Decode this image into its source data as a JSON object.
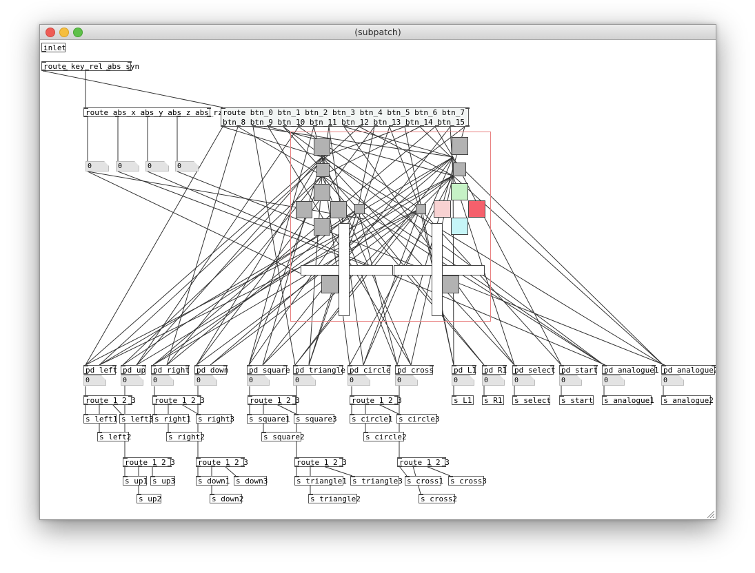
{
  "window": {
    "title": "(subpatch)",
    "colors": {
      "close": "#ee5c55",
      "minimize": "#f5be3f",
      "zoom": "#5fc04a",
      "gop_border": "#e88080"
    }
  },
  "objects": {
    "inlet": "inlet",
    "route_main": "route key rel abs syn",
    "route_abs": "route abs_x abs_y abs_z abs_rz",
    "route_btn": "route btn_0 btn_1 btn_2 btn_3 btn_4 btn_5 btn_6 btn_7 btn_8 btn_9 btn_10 btn_11 btn_12 btn_13 btn_14 btn_15",
    "pd_left": "pd left",
    "pd_up": "pd up",
    "pd_right": "pd right",
    "pd_down": "pd down",
    "pd_square": "pd square",
    "pd_triangle": "pd triangle",
    "pd_circle": "pd circle",
    "pd_cross": "pd cross",
    "pd_l1": "pd L1",
    "pd_r1": "pd R1",
    "pd_select": "pd select",
    "pd_start": "pd start",
    "pd_analogue1": "pd analogue1",
    "pd_analogue2": "pd analogue2",
    "route_123": "route 1 2 3",
    "s_left1": "s left1",
    "s_left2": "s left2",
    "s_left3": "s left3",
    "s_right1": "s right1",
    "s_right2": "s right2",
    "s_right3": "s right3",
    "s_square1": "s square1",
    "s_square2": "s square2",
    "s_square3": "s square3",
    "s_circle1": "s circle1",
    "s_circle2": "s circle2",
    "s_circle3": "s circle3",
    "s_up1": "s up1",
    "s_up2": "s up2",
    "s_up3": "s up3",
    "s_down1": "s down1",
    "s_down2": "s down2",
    "s_down3": "s down3",
    "s_triangle1": "s triangle1",
    "s_triangle2": "s triangle2",
    "s_triangle3": "s triangle3",
    "s_cross1": "s cross1",
    "s_cross2": "s cross2",
    "s_cross3": "s cross3",
    "s_l1": "s L1",
    "s_r1": "s R1",
    "s_select": "s select",
    "s_start": "s start",
    "s_analogue1": "s analogue1",
    "s_analogue2": "s analogue2"
  },
  "number_value": "0",
  "gui_colors": {
    "button_gray": "#b2b2b2",
    "triangle_green": "#c6f2c6",
    "square_pink": "#f8d2d2",
    "circle_red": "#f5606c",
    "cross_cyan": "#c6f6f8"
  }
}
